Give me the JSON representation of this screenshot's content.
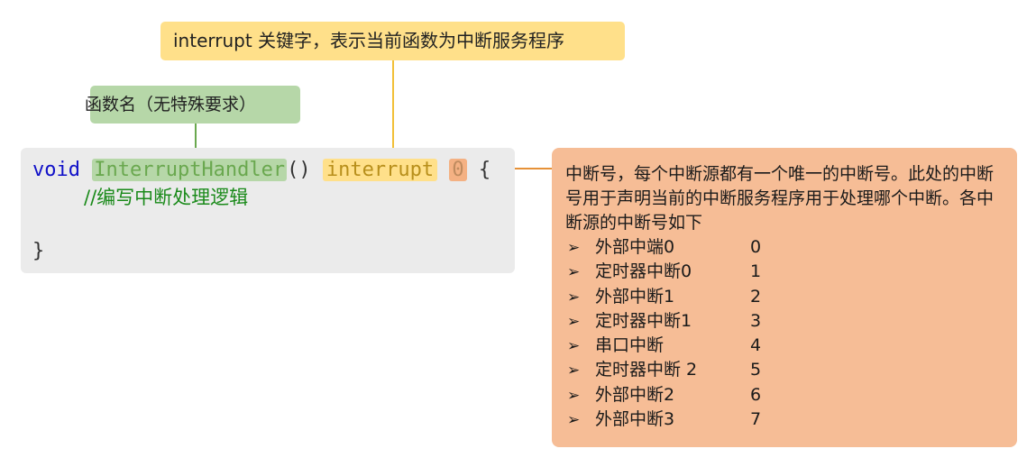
{
  "callouts": {
    "interrupt_keyword": "interrupt 关键字，表示当前函数为中断服务程序",
    "function_name": "函数名（无特殊要求）"
  },
  "code": {
    "void": "void",
    "function_name": "InterruptHandler",
    "parens": "()",
    "interrupt": "interrupt",
    "number": "0",
    "brace_open": "{",
    "comment": "//编写中断处理逻辑",
    "brace_close": "}"
  },
  "info": {
    "description": "中断号，每个中断源都有一个唯一的中断号。此处的中断号用于声明当前的中断服务程序用于处理哪个中断。各中断源的中断号如下",
    "items": [
      {
        "name": "外部中端0",
        "number": "0"
      },
      {
        "name": "定时器中断0",
        "number": "1"
      },
      {
        "name": "外部中断1",
        "number": "2"
      },
      {
        "name": "定时器中断1",
        "number": "3"
      },
      {
        "name": "串口中断",
        "number": "4"
      },
      {
        "name": "定时器中断 2",
        "number": "5"
      },
      {
        "name": "外部中断2",
        "number": "6"
      },
      {
        "name": "外部中断3",
        "number": "7"
      }
    ],
    "bullet_icon": "arrowhead-bullet-icon"
  },
  "colors": {
    "yellow_highlight": "#ffe08a",
    "green_highlight": "#b6d7a8",
    "orange_highlight": "#f4b183",
    "info_background": "#f6bd96",
    "code_background": "#ebebeb",
    "keyword_blue": "#1010c8",
    "comment_green": "#1a8a1a"
  }
}
